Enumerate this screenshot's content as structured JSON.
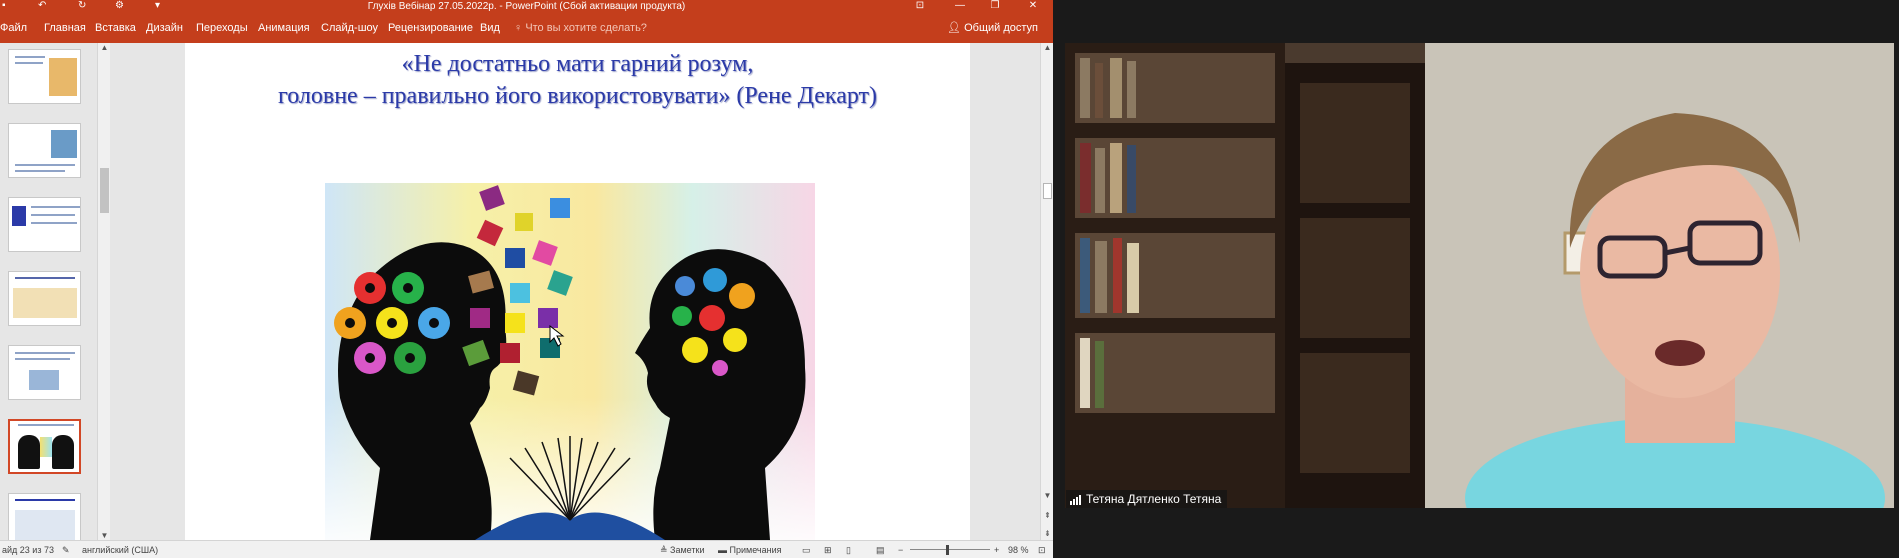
{
  "window": {
    "title": "Глухів Вебінар 27.05.2022р. - PowerPoint (Сбой активации продукта)"
  },
  "ribbon": {
    "tabs": [
      "Файл",
      "Главная",
      "Вставка",
      "Дизайн",
      "Переходы",
      "Анимация",
      "Слайд-шоу",
      "Рецензирование",
      "Вид"
    ],
    "search_placeholder": "Что вы хотите сделать?",
    "share_label": "Общий доступ"
  },
  "thumbnails": {
    "active_index": 5
  },
  "slide": {
    "quote_line1": "«Не достатньо мати гарний розум,",
    "quote_line2": "головне – правильно його використовувати» (Рене Декарт)"
  },
  "statusbar": {
    "slide_counter": "айд 23 из 73",
    "language": "английский (США)",
    "notes_label": "Заметки",
    "comments_label": "Примечания",
    "zoom_label": "98 %"
  },
  "video": {
    "participant_name": "Тетяна Дятленко Тетяна"
  },
  "colors": {
    "ribbon": "#c43e1c",
    "quote_text": "#2b3aa8",
    "active_thumb_border": "#d24726"
  }
}
